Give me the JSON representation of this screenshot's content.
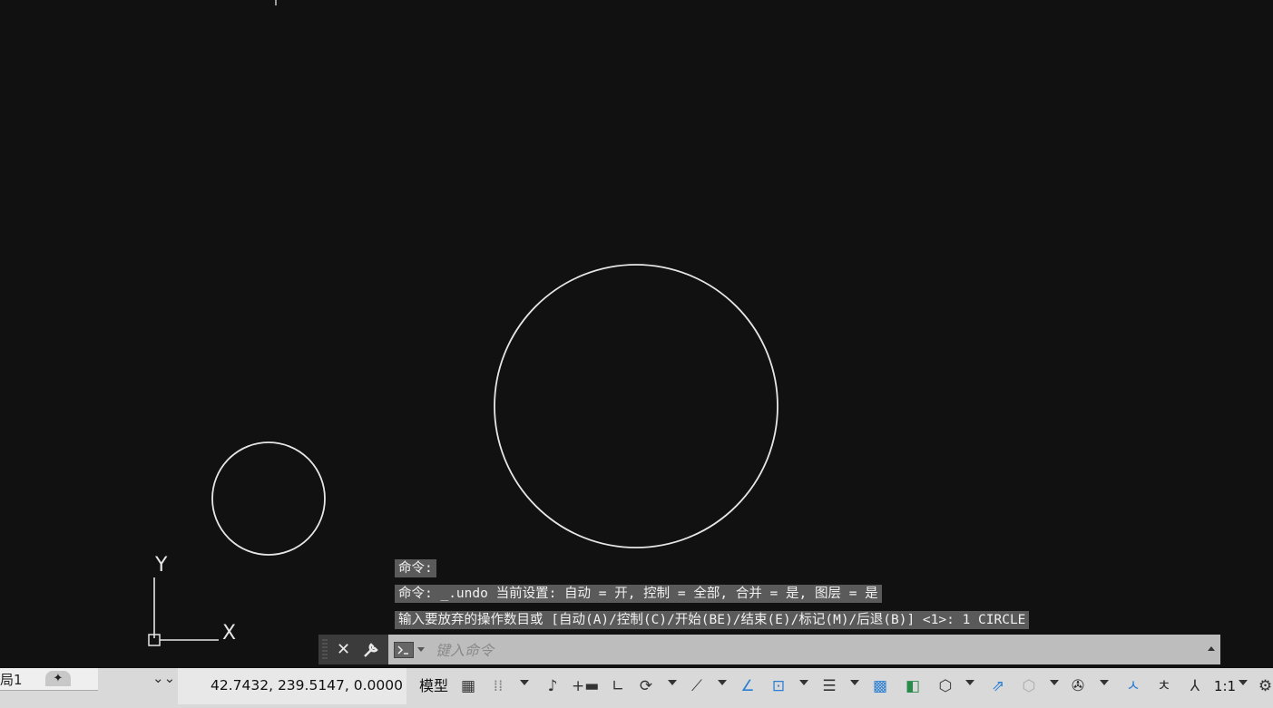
{
  "ucs": {
    "y_label": "Y",
    "x_label": "X"
  },
  "history": [
    "命令:",
    "命令: _.undo 当前设置: 自动 = 开, 控制 = 全部, 合并 = 是, 图层 = 是",
    "输入要放弃的操作数目或 [自动(A)/控制(C)/开始(BE)/结束(E)/标记(M)/后退(B)] <1>: 1 CIRCLE"
  ],
  "command_line": {
    "placeholder": "键入命令"
  },
  "status_bar": {
    "layout_tab": "局1",
    "coordinates": "42.7432, 239.5147, 0.0000",
    "model_label": "模型",
    "scale_label": "1:1"
  },
  "colors": {
    "canvas_bg": "#111111",
    "geometry": "#e6e6e6",
    "accent": "#2a7fd4"
  }
}
